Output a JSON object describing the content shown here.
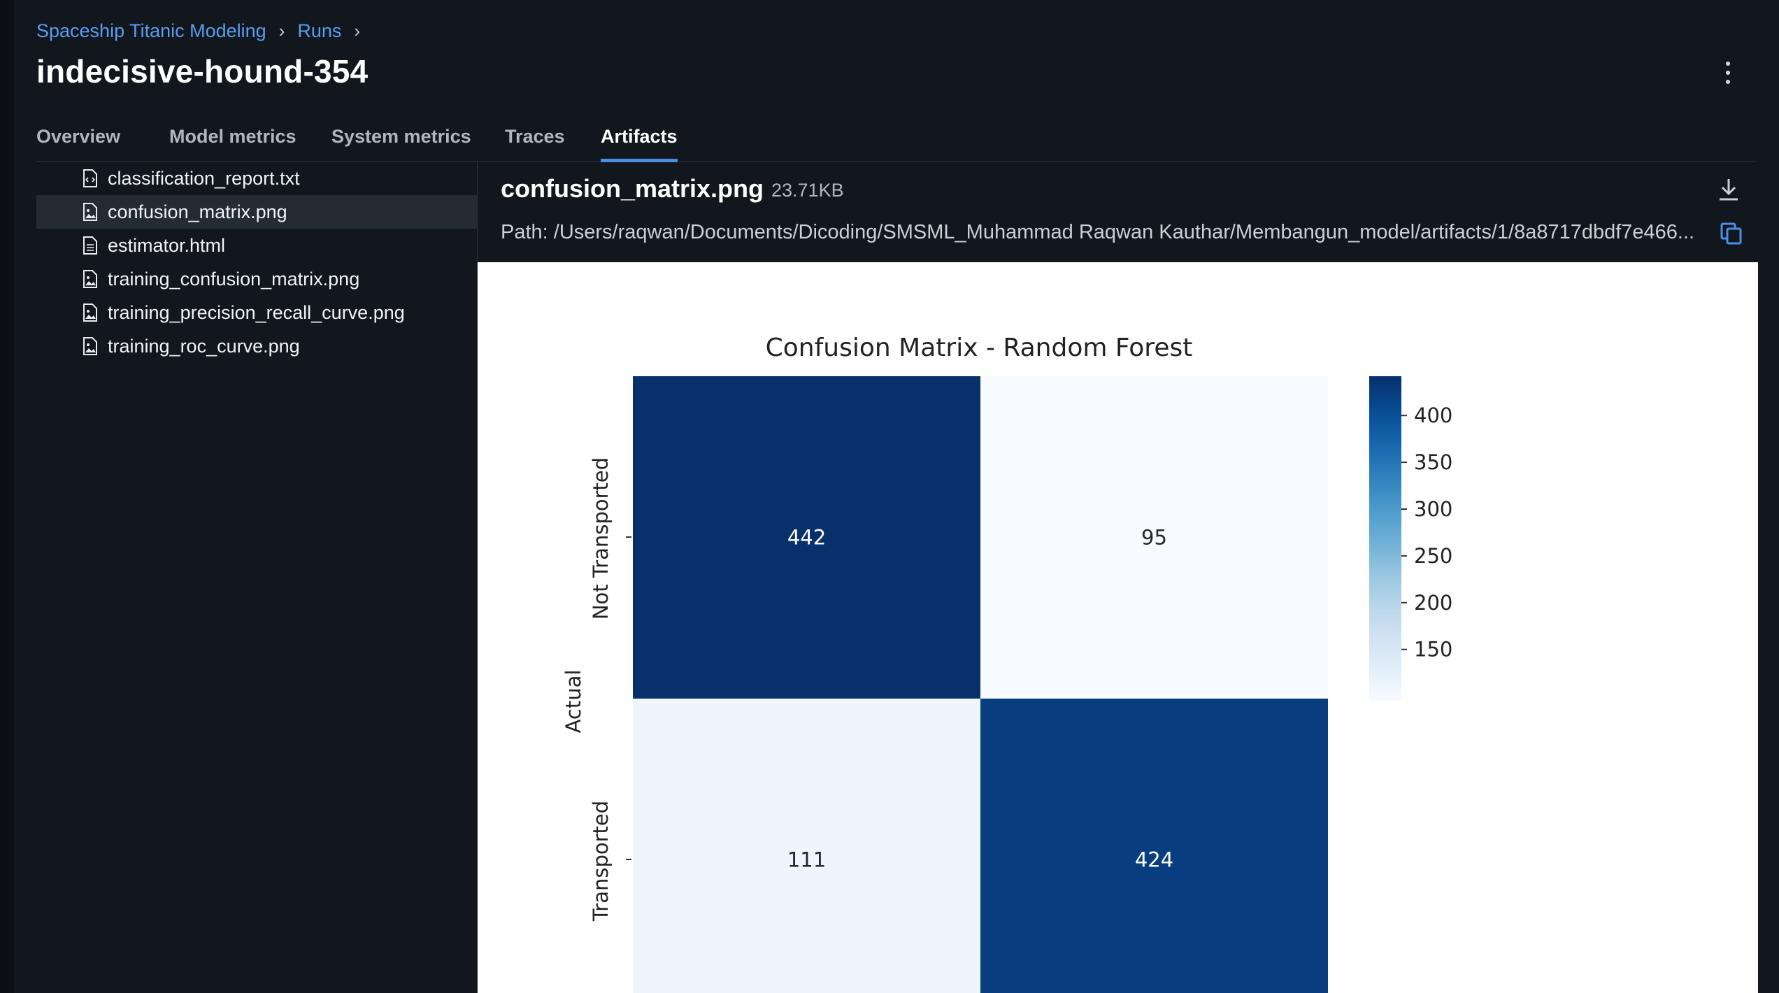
{
  "breadcrumb": {
    "experiment": "Spaceship Titanic Modeling",
    "runs": "Runs"
  },
  "run": {
    "title": "indecisive-hound-354"
  },
  "tabs": [
    {
      "label": "Overview"
    },
    {
      "label": "Model metrics"
    },
    {
      "label": "System metrics"
    },
    {
      "label": "Traces"
    },
    {
      "label": "Artifacts"
    }
  ],
  "active_tab": "Artifacts",
  "files": [
    {
      "name": "classification_report.txt",
      "icon": "code-file-icon"
    },
    {
      "name": "confusion_matrix.png",
      "icon": "image-file-icon",
      "selected": true
    },
    {
      "name": "estimator.html",
      "icon": "text-file-icon"
    },
    {
      "name": "training_confusion_matrix.png",
      "icon": "image-file-icon"
    },
    {
      "name": "training_precision_recall_curve.png",
      "icon": "image-file-icon"
    },
    {
      "name": "training_roc_curve.png",
      "icon": "image-file-icon"
    }
  ],
  "artifact": {
    "name": "confusion_matrix.png",
    "size": "23.71KB",
    "path": "Path: /Users/raqwan/Documents/Dicoding/SMSML_Muhammad Raqwan Kauthar/Membangun_model/artifacts/1/8a8717dbdf7e466..."
  },
  "colors": {
    "accent": "#4a8fe6",
    "link": "#5b9bf0"
  },
  "chart_data": {
    "type": "heatmap",
    "title": "Confusion Matrix - Random Forest",
    "ylabel": "Actual",
    "row_labels": [
      "Not Transported",
      "Transported"
    ],
    "values": [
      [
        442,
        95
      ],
      [
        111,
        424
      ]
    ],
    "colorbar": {
      "ticks": [
        400,
        350,
        300,
        250,
        200,
        150
      ],
      "range": [
        95,
        442
      ],
      "colormap": "Blues"
    }
  }
}
